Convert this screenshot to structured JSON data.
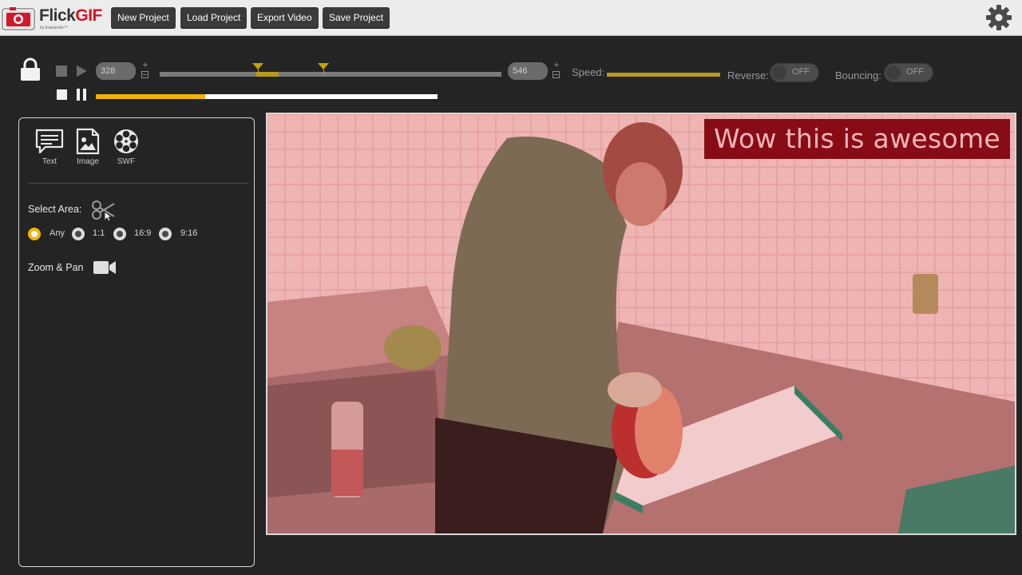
{
  "app": {
    "brand_main": "Flick",
    "brand_accent": "GIF",
    "brand_sub": "by Explaindio™",
    "accent_color": "#f0b400"
  },
  "toolbar": {
    "new_project": "New Project",
    "load_project": "Load Project",
    "export_video": "Export Video",
    "save_project": "Save Project",
    "settings_icon": "gear-icon"
  },
  "playback": {
    "start_frame": "328",
    "end_frame": "546",
    "speed_label": "Speed:",
    "reverse_label": "Reverse:",
    "reverse_state": "OFF",
    "bouncing_label": "Bouncing:",
    "bouncing_state": "OFF",
    "progress_percent": 32
  },
  "sidebar": {
    "tools": [
      {
        "label": "Text",
        "icon": "text-bubble-icon"
      },
      {
        "label": "Image",
        "icon": "image-icon"
      },
      {
        "label": "SWF",
        "icon": "film-reel-icon"
      }
    ],
    "select_area_label": "Select Area:",
    "aspect_options": [
      {
        "label": "Any",
        "selected": true
      },
      {
        "label": "1:1",
        "selected": false
      },
      {
        "label": "16:9",
        "selected": false
      },
      {
        "label": "9:16",
        "selected": false
      }
    ],
    "zoom_pan_label": "Zoom & Pan"
  },
  "preview": {
    "caption_text": "Wow this is awesome"
  }
}
